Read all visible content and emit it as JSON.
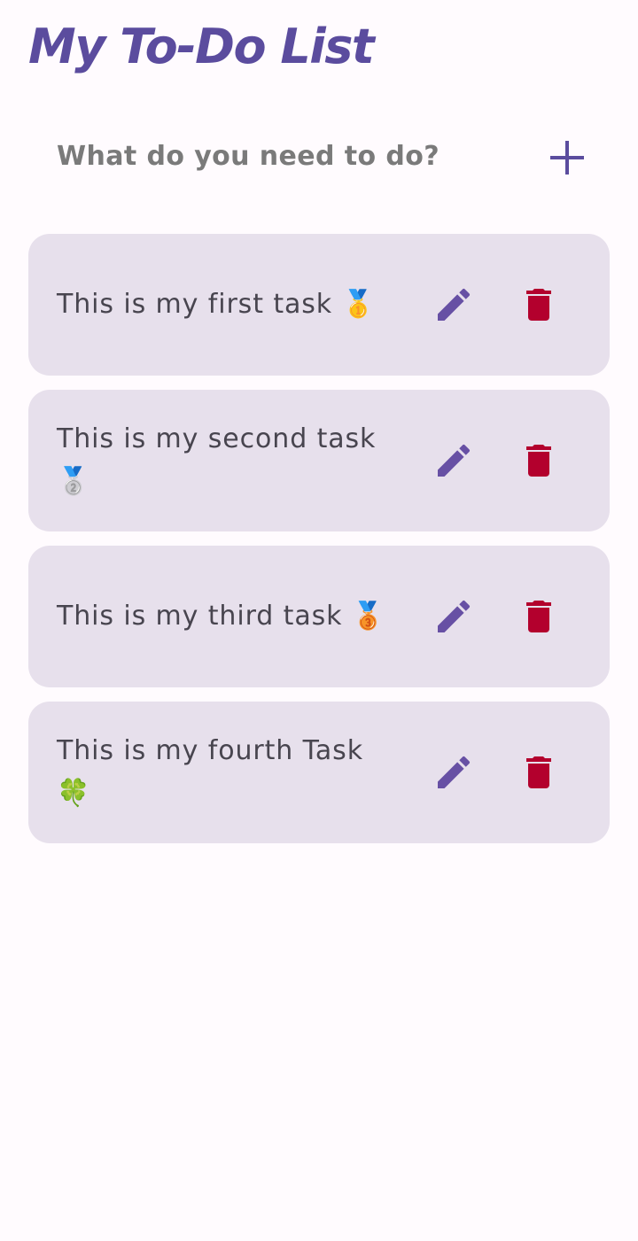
{
  "app": {
    "title": "My To-Do List"
  },
  "new_task": {
    "placeholder": "What do you need to do?",
    "value": "",
    "add_icon": "plus-icon"
  },
  "tasks": [
    {
      "text": "This is my first task 🥇",
      "edit_icon": "pencil-icon",
      "delete_icon": "trash-icon"
    },
    {
      "text": "This is my second task 🥈",
      "edit_icon": "pencil-icon",
      "delete_icon": "trash-icon"
    },
    {
      "text": "This is my third task 🥉",
      "edit_icon": "pencil-icon",
      "delete_icon": "trash-icon"
    },
    {
      "text": "This is my fourth Task 🍀",
      "edit_icon": "pencil-icon",
      "delete_icon": "trash-icon"
    }
  ],
  "colors": {
    "primary": "#5b4c9e",
    "edit_icon": "#6750a4",
    "delete_icon": "#b3002d",
    "card_background": "#e7e0ec",
    "page_background": "#fffbfe"
  }
}
